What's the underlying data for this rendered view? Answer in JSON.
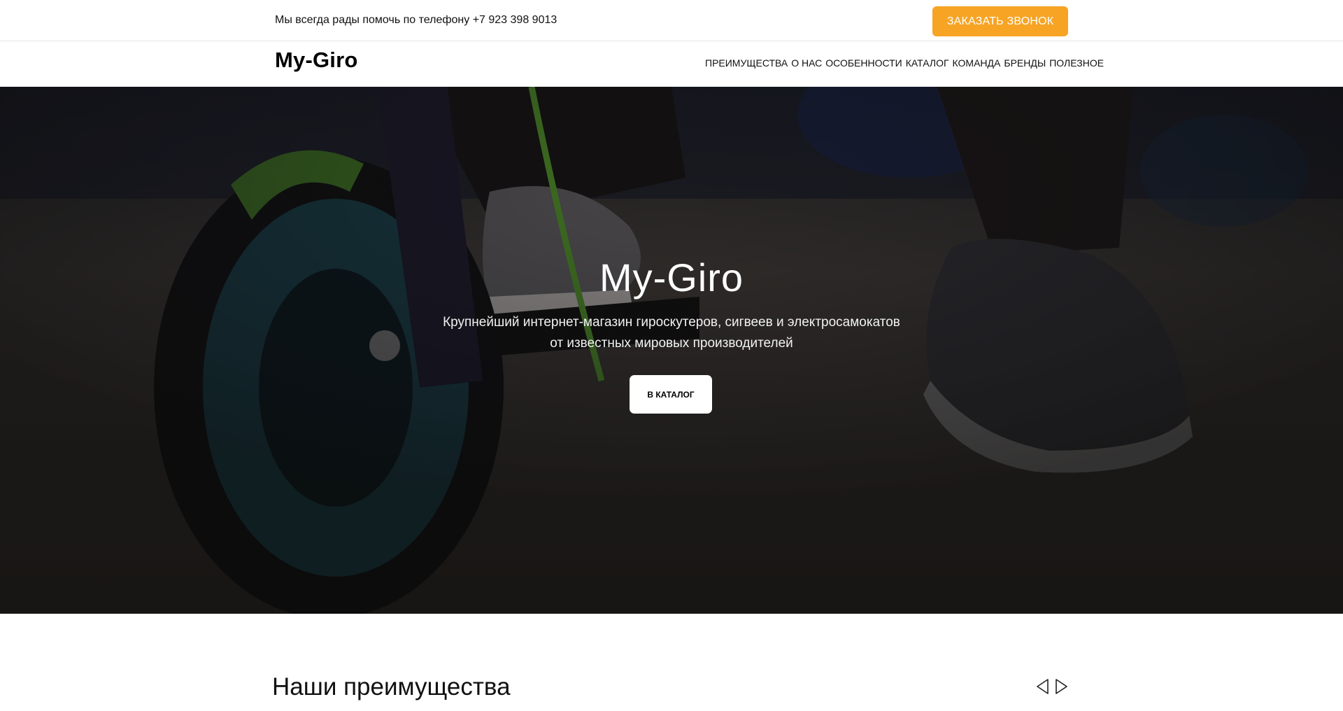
{
  "topbar": {
    "phone_text": "Мы всегда рады помочь по телефону +7 923 398 9013",
    "callback_label": "ЗАКАЗАТЬ ЗВОНОК",
    "accent_color": "#f7a424"
  },
  "navbar": {
    "logo": "My-Giro",
    "menu": [
      "ПРЕИМУЩЕСТВА",
      "О НАС",
      "ОСОБЕННОСТИ",
      "КАТАЛОГ",
      "КОМАНДА",
      "БРЕНДЫ",
      "ПОЛЕЗНОЕ"
    ]
  },
  "hero": {
    "title": "My-Giro",
    "subtitle_line1": "Крупнейший интернет-магазин гироскутеров, сигвеев и электросамокатов",
    "subtitle_line2": "от известных мировых производителей",
    "catalog_label": "В КАТАЛОГ",
    "background_image": "kick-scooter-wheel-and-sneakers-photo"
  },
  "advantages": {
    "title": "Наши преимущества",
    "prev_icon": "triangle-left-outline-icon",
    "next_icon": "triangle-right-outline-icon"
  }
}
